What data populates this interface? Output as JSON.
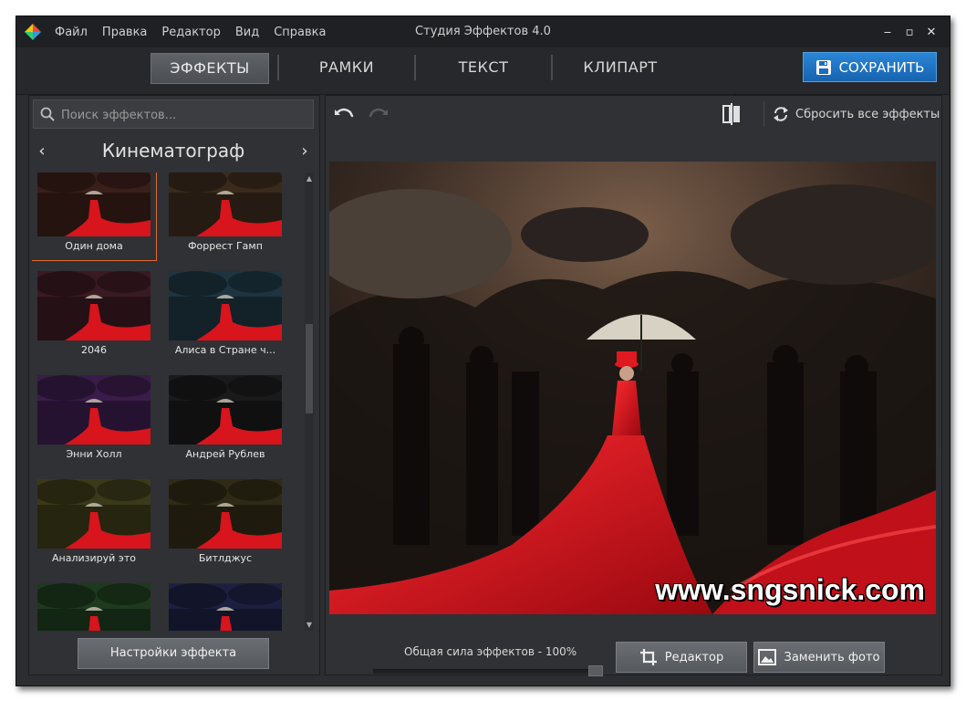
{
  "titlebar": {
    "menu": [
      "Файл",
      "Правка",
      "Редактор",
      "Вид",
      "Справка"
    ],
    "title": "Студия Эффектов 4.0",
    "controls": [
      "‒",
      "▫",
      "✕"
    ]
  },
  "tabs": [
    {
      "label": "ЭФФЕКТЫ",
      "active": true
    },
    {
      "label": "РАМКИ",
      "active": false
    },
    {
      "label": "ТЕКСТ",
      "active": false
    },
    {
      "label": "КЛИПАРТ",
      "active": false
    }
  ],
  "save_label": "СОХРАНИТЬ",
  "sidebar": {
    "search_placeholder": "Поиск эффектов...",
    "category": "Кинематограф",
    "prev_arrow": "‹",
    "next_arrow": "›",
    "effects": [
      {
        "label": "Один дома",
        "tint": "#3a1e1a",
        "selected": true
      },
      {
        "label": "Форрест Гамп",
        "tint": "#3a2a1c",
        "selected": false
      },
      {
        "label": "2046",
        "tint": "#3a1a22",
        "selected": false
      },
      {
        "label": "Алиса в Стране ч...",
        "tint": "#1e3440",
        "selected": false
      },
      {
        "label": "Энни Холл",
        "tint": "#3a1c4a",
        "selected": false
      },
      {
        "label": "Андрей Рублев",
        "tint": "#1a1a1a",
        "selected": false
      },
      {
        "label": "Анализируй это",
        "tint": "#3a3a1a",
        "selected": false
      },
      {
        "label": "Битлджус",
        "tint": "#2e2a16",
        "selected": false
      },
      {
        "label": "",
        "tint": "#1e3a1e",
        "selected": false
      },
      {
        "label": "",
        "tint": "#1c2040",
        "selected": false
      }
    ],
    "settings_label": "Настройки эффекта"
  },
  "toolbar": {
    "reset_label": "Сбросить все эффекты"
  },
  "preview": {
    "watermark": "www.sngsnick.com"
  },
  "bottom": {
    "strength_label": "Общая сила эффектов - 100%",
    "strength_value": 100,
    "editor_label": "Редактор",
    "replace_label": "Заменить фото"
  },
  "colors": {
    "accent": "#1d72c4",
    "selection": "#e06a2c",
    "dress": "#d31020"
  }
}
